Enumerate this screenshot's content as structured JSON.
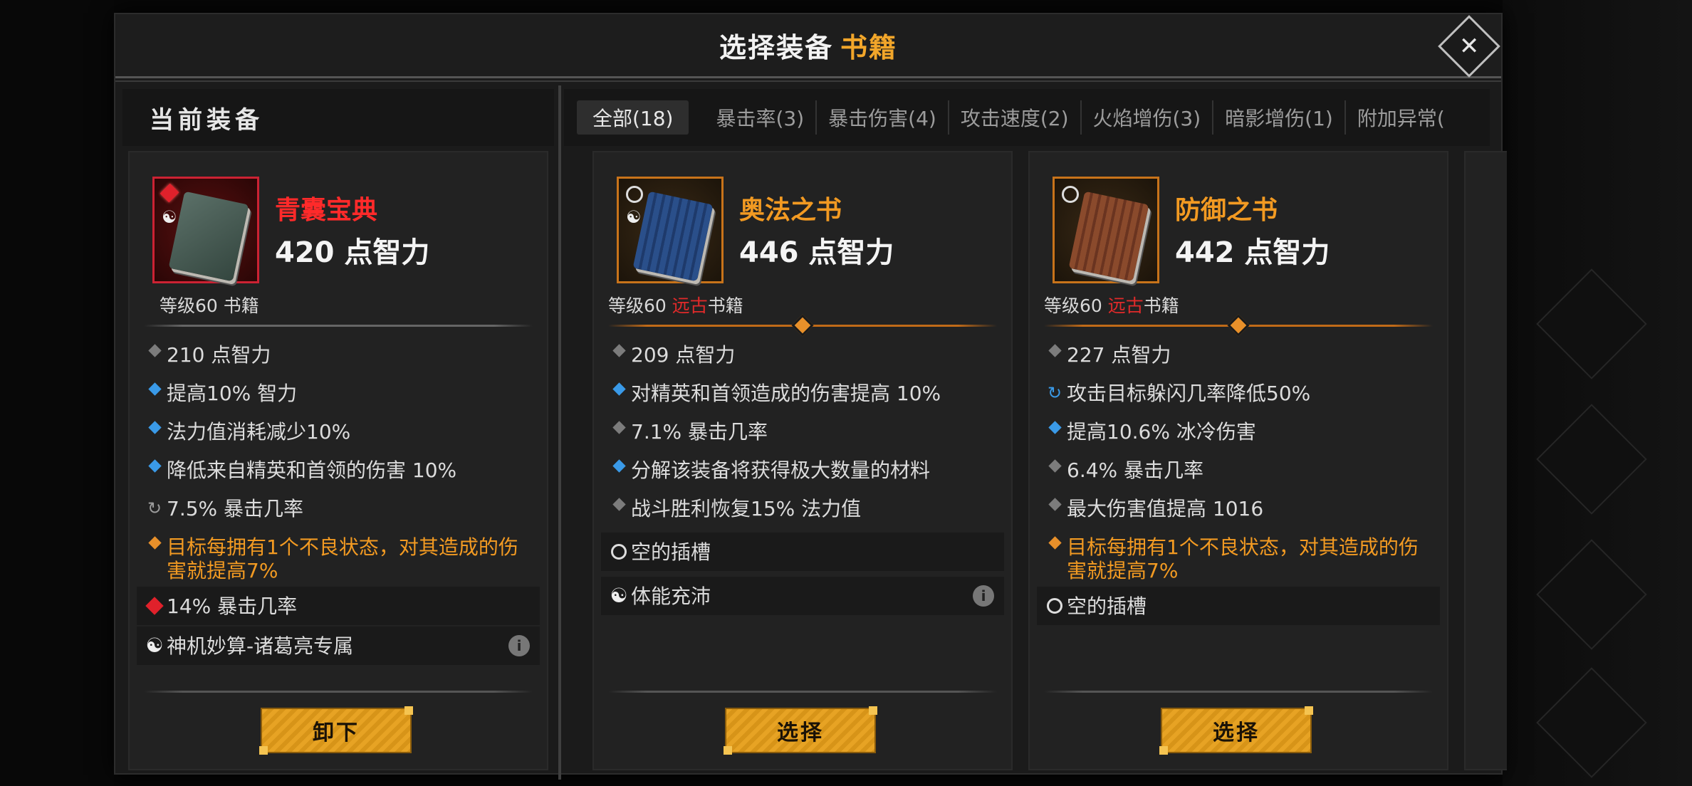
{
  "header": {
    "title_prefix": "选择装备",
    "title_highlight": "书籍",
    "close_symbol": "✕"
  },
  "current": {
    "heading": "当前装备",
    "item": {
      "name": "青囊宝典",
      "main_stat": "420 点智力",
      "level_prefix": "等级60 ",
      "level_tag": "",
      "level_suffix": "书籍",
      "affixes": [
        {
          "marker": "diamond-gray",
          "text": "210 点智力"
        },
        {
          "marker": "diamond-blue",
          "text": "提高10% 智力"
        },
        {
          "marker": "diamond-blue",
          "text": "法力值消耗减少10%"
        },
        {
          "marker": "diamond-blue",
          "text": "降低来自精英和首领的伤害 10%"
        },
        {
          "marker": "reroll-gray",
          "text": "7.5% 暴击几率"
        },
        {
          "marker": "diamond-orange",
          "text": "目标每拥有1个不良状态，对其造成的伤害就提高7%"
        },
        {
          "marker": "gem-red",
          "text": "14% 暴击几率"
        },
        {
          "marker": "yinyang",
          "text": "神机妙算-诸葛亮专属"
        }
      ],
      "button": "卸下"
    }
  },
  "tabs": [
    {
      "label": "全部(18)",
      "active": true
    },
    {
      "label": "暴击率(3)"
    },
    {
      "label": "暴击伤害(4)"
    },
    {
      "label": "攻击速度(2)"
    },
    {
      "label": "火焰增伤(3)"
    },
    {
      "label": "暗影增伤(1)"
    },
    {
      "label": "附加异常("
    }
  ],
  "candidates": [
    {
      "name": "奥法之书",
      "main_stat": "446 点智力",
      "level_prefix": "等级60 ",
      "level_tag": "远古",
      "level_suffix": "书籍",
      "affixes": [
        {
          "text": "209 点智力"
        },
        {
          "text": "对精英和首领造成的伤害提高 10%"
        },
        {
          "text": "7.1% 暴击几率"
        },
        {
          "text": "分解该装备将获得极大数量的材料"
        },
        {
          "text": "战斗胜利恢复15% 法力值"
        },
        {
          "text": "空的插槽"
        },
        {
          "text": "体能充沛"
        }
      ],
      "button": "选择"
    },
    {
      "name": "防御之书",
      "main_stat": "442 点智力",
      "level_prefix": "等级60 ",
      "level_tag": "远古",
      "level_suffix": "书籍",
      "affixes": [
        {
          "text": "227 点智力"
        },
        {
          "text": "攻击目标躲闪几率降低50%"
        },
        {
          "text": "提高10.6% 冰冷伤害"
        },
        {
          "text": "6.4% 暴击几率"
        },
        {
          "text": "最大伤害值提高 1016"
        },
        {
          "text": "目标每拥有1个不良状态，对其造成的伤害就提高7%"
        },
        {
          "text": "空的插槽"
        }
      ],
      "button": "选择"
    }
  ],
  "colors": {
    "accent": "#f2a62a",
    "legendary_red": "#ff2a2a",
    "ancient_red": "#e12a2a",
    "orange_text": "#f29a22",
    "blue_marker": "#3a9ae8"
  }
}
